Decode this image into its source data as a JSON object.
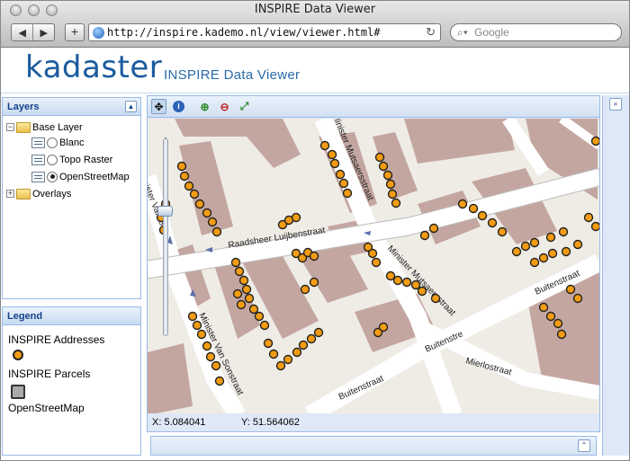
{
  "window": {
    "title": "INSPIRE Data Viewer"
  },
  "browser": {
    "back_icon": "back-arrow-icon",
    "forward_icon": "forward-arrow-icon",
    "add_icon": "plus-icon",
    "url": "http://inspire.kademo.nl/view/viewer.html#",
    "search_placeholder": "Google"
  },
  "header": {
    "logo": "kadaster",
    "title": "INSPIRE Data Viewer"
  },
  "layers_panel": {
    "title": "Layers",
    "tree": {
      "base_layer": "Base Layer",
      "blanc": "Blanc",
      "topo_raster": "Topo Raster",
      "openstreetmap": "OpenStreetMap",
      "selected": "OpenStreetMap",
      "overlays": "Overlays"
    }
  },
  "legend_panel": {
    "title": "Legend",
    "items": [
      "INSPIRE Addresses",
      "INSPIRE Parcels",
      "OpenStreetMap"
    ]
  },
  "map": {
    "tools": [
      "pan-tool-icon",
      "info-tool-icon",
      "zoom-in-icon",
      "zoom-out-icon",
      "zoom-extent-icon"
    ],
    "streets": [
      "Minister Mutsaersstraat",
      "Raadsheer Luijbenstraat",
      "Minister Van Sonstraat",
      "Buitenstraat",
      "Buitenstre",
      "Mierlostraat",
      "Minister Van Son"
    ],
    "coords": {
      "x": "X: 5.084041",
      "y": "Y: 51.564062"
    }
  },
  "colors": {
    "address_point": "#f39c12",
    "building": "#c4a6a1",
    "road": "#ffffff",
    "panel_border": "#99bbe8",
    "panel_header_text": "#15428b"
  }
}
